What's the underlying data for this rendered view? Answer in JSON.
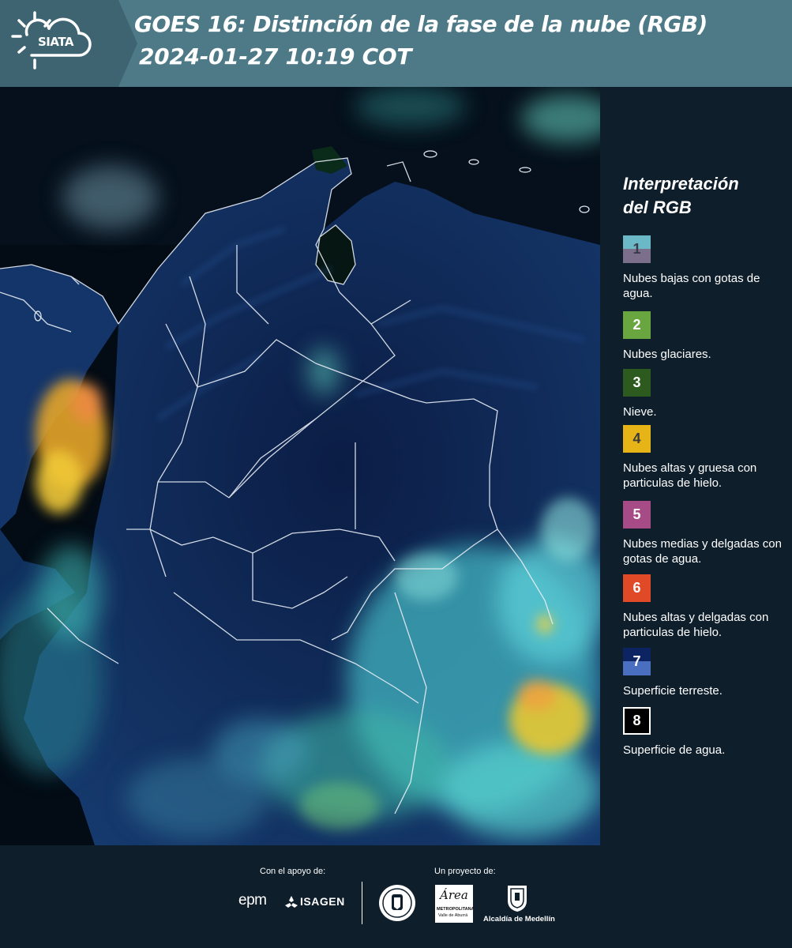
{
  "header": {
    "logo_text": "SIATA",
    "title_line1": "GOES 16: Distinción de la fase de la nube (RGB)",
    "title_line2": "2024-01-27 10:19 COT"
  },
  "legend": {
    "title_line1": "Interpretación",
    "title_line2": "del RGB",
    "items": [
      {
        "number": "1",
        "label": "Nubes bajas con gotas de agua.",
        "color_top": "#6bb8c6",
        "color_bottom": "#7b6f8c",
        "number_color": "#3a3a4a"
      },
      {
        "number": "2",
        "label": "Nubes glaciares.",
        "color_top": "#6aa640",
        "color_bottom": "#6aa640",
        "number_color": "#ffffff"
      },
      {
        "number": "3",
        "label": "Nieve.",
        "color_top": "#2d5a1e",
        "color_bottom": "#2d5a1e",
        "number_color": "#ffffff"
      },
      {
        "number": "4",
        "label": "Nubes altas y gruesa con particulas de hielo.",
        "color_top": "#e6b417",
        "color_bottom": "#e6b417",
        "number_color": "#3a3a3a"
      },
      {
        "number": "5",
        "label": "Nubes medias y delgadas con gotas de agua.",
        "color_top": "#a74b86",
        "color_bottom": "#a74b86",
        "number_color": "#ffffff"
      },
      {
        "number": "6",
        "label": "Nubes altas y delgadas con particulas de hielo.",
        "color_top": "#e04a27",
        "color_bottom": "#e04a27",
        "number_color": "#ffffff"
      },
      {
        "number": "7",
        "label": "Superficie terreste.",
        "color_top": "#0d2463",
        "color_bottom": "#4a6fc0",
        "number_color": "#ffffff"
      },
      {
        "number": "8",
        "label": "Superficie de agua.",
        "color_top": "#000000",
        "color_bottom": "#000000",
        "number_color": "#ffffff"
      }
    ]
  },
  "footer": {
    "support_label": "Con el apoyo de:",
    "project_label": "Un proyecto de:",
    "sponsor1": "epm",
    "sponsor2": "ISAGEN",
    "partner_area_line1": "Área",
    "partner_area_line2": "METROPOLITANA",
    "partner_area_line3": "Valle de Aburrá",
    "partner_alcaldia": "Alcaldía de Medellín"
  },
  "colors": {
    "header_bg": "#4e7a88",
    "logo_bg": "#3e6472",
    "page_bg": "#0e1e2b",
    "map_water": "#030b14",
    "map_land": "#0f2a52",
    "cloud_low": "#4fc6c0",
    "cloud_high_thick": "#e6b417"
  }
}
